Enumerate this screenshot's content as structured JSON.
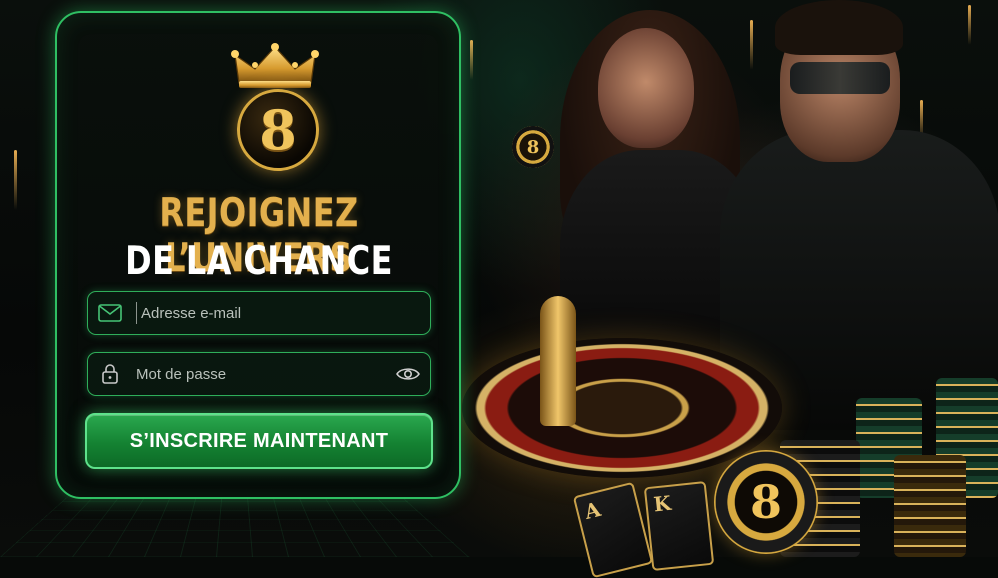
{
  "hero": {
    "headline_line1": "REJOIGNEZ L’UNIVERS",
    "headline_line2": "DE LA CHANCE",
    "logo_mark": "8",
    "logo_icon": "crown-8-icon"
  },
  "form": {
    "email_placeholder": "Adresse e-mail",
    "email_value": "",
    "email_icon": "envelope-icon",
    "password_placeholder": "Mot de passe",
    "password_value": "",
    "password_icon": "lock-icon",
    "password_toggle_icon": "eye-icon",
    "submit_label": "S’INSCRIRE MAINTENANT"
  },
  "scene": {
    "chip_mark": "8",
    "card_left": "A",
    "card_right": "K"
  },
  "colors": {
    "accent_green": "#2fbf63",
    "gold": "#e3b04d",
    "panel_bg": "#0a100c"
  }
}
